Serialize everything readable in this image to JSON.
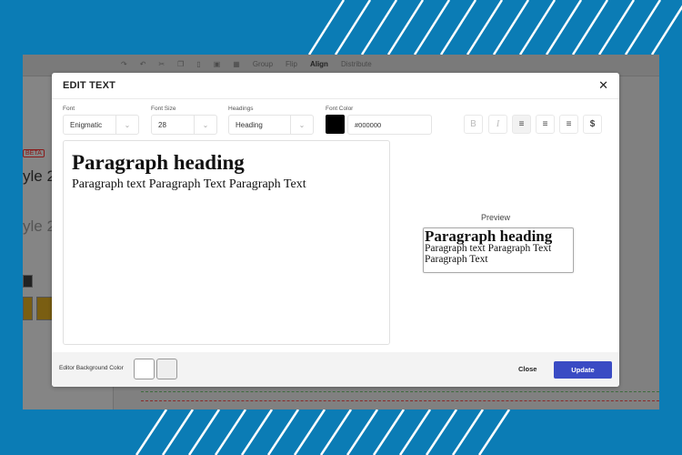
{
  "colors": {
    "background": "#0b7cb5",
    "accent": "#3a4bc4",
    "font_color": "#000000"
  },
  "background_app": {
    "toolbar": [
      "Group",
      "Flip",
      "Align",
      "Distribute"
    ],
    "sidebar": {
      "badge": "BETA",
      "items": [
        "yle 2",
        "yle 2"
      ]
    }
  },
  "modal": {
    "title": "EDIT TEXT",
    "close_icon": "close-icon",
    "font": {
      "label": "Font",
      "value": "Enigmatic"
    },
    "font_size": {
      "label": "Font Size",
      "value": "28"
    },
    "headings": {
      "label": "Headings",
      "value": "Heading"
    },
    "font_color": {
      "label": "Font Color",
      "value": "#000000"
    },
    "format_buttons": [
      {
        "icon": "bold-icon",
        "glyph": "B"
      },
      {
        "icon": "italic-icon",
        "glyph": "I"
      },
      {
        "icon": "align-left-icon",
        "glyph": "≡",
        "active": true
      },
      {
        "icon": "align-center-icon",
        "glyph": "≡"
      },
      {
        "icon": "align-right-icon",
        "glyph": "≡"
      },
      {
        "icon": "dollar-icon",
        "glyph": "$"
      }
    ],
    "editor": {
      "heading": "Paragraph heading",
      "text": "Paragraph text Paragraph Text Paragraph Text"
    },
    "preview": {
      "label": "Preview",
      "heading": "Paragraph heading",
      "text": "Paragraph text Paragraph Text Paragraph Text"
    },
    "footer": {
      "bg_label": "Editor Background Color",
      "close": "Close",
      "update": "Update"
    }
  }
}
